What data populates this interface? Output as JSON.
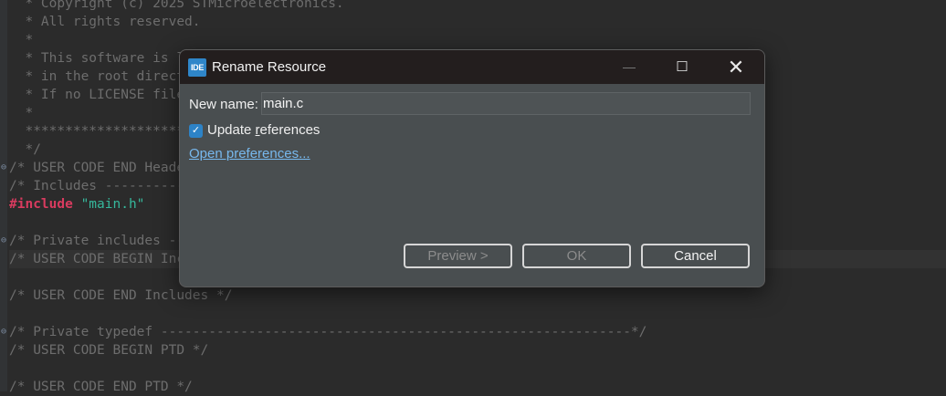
{
  "editor": {
    "lines": [
      {
        "text": "  * Copyright (c) 2025 STMicroelectronics."
      },
      {
        "text": "  * All rights reserved."
      },
      {
        "text": "  *"
      },
      {
        "text": "  * This software is licensed under terms that can be found in the LICENSE file"
      },
      {
        "text": "  * in the root directory of this software component."
      },
      {
        "text": "  * If no LICENSE file comes with this software, it is provided AS-IS."
      },
      {
        "text": "  *"
      },
      {
        "text": "  ******************************************************************************"
      },
      {
        "text": "  */"
      },
      {
        "text": "/* USER CODE END Header */",
        "fold": true
      },
      {
        "text": "/* Includes ------------------------------------------------------------------*/"
      },
      {
        "parts": [
          {
            "text": "#include",
            "cls": "kw"
          },
          {
            "text": " "
          },
          {
            "text": "\"main.h\"",
            "cls": "str"
          }
        ]
      },
      {
        "text": ""
      },
      {
        "text": "/* Private includes ----------------------------------------------------------*/",
        "fold": true
      },
      {
        "text": "/* USER CODE BEGIN Includes */",
        "current": true
      },
      {
        "text": ""
      },
      {
        "text": "/* USER CODE END Includes */"
      },
      {
        "text": ""
      },
      {
        "text": "/* Private typedef -----------------------------------------------------------*/",
        "fold": true
      },
      {
        "text": "/* USER CODE BEGIN PTD */"
      },
      {
        "text": ""
      },
      {
        "text": "/* USER CODE END PTD */"
      }
    ]
  },
  "dialog": {
    "icon_text": "IDE",
    "title": "Rename Resource",
    "window_controls": {
      "minimize": "—",
      "maximize": "☐",
      "close": "✕"
    },
    "name_label": "New name:",
    "name_value": "main.c",
    "checkbox": {
      "checked": true,
      "mark": "✓",
      "label": "Update references",
      "mnemonic": "r"
    },
    "link": "Open preferences...",
    "buttons": {
      "preview": "Preview >",
      "ok": "OK",
      "cancel": "Cancel"
    }
  },
  "colors": {
    "editor_bg": "#2b2b2b",
    "comment": "#6d6d6d",
    "keyword": "#d93b5f",
    "string": "#36b89c",
    "dialog_bg": "#494e50",
    "titlebar_bg": "#231e1e",
    "accent": "#2d83c7",
    "link": "#77b8ed"
  }
}
